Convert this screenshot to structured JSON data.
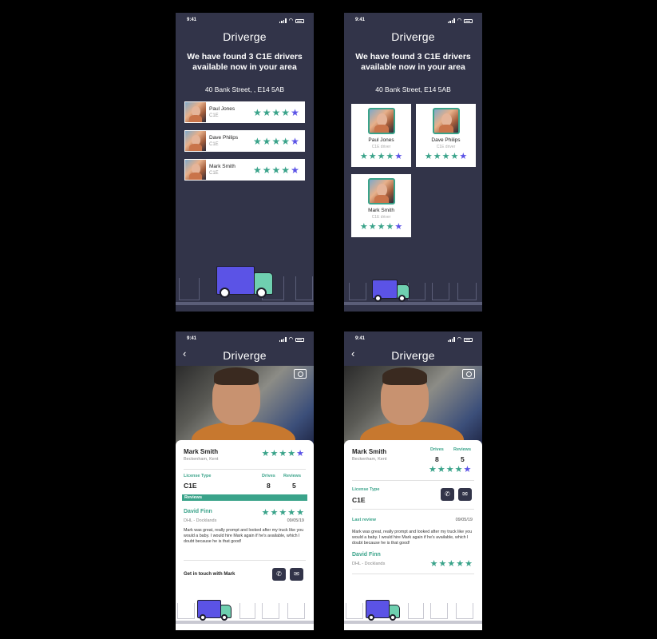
{
  "status_time": "9:41",
  "brand": "Driverge",
  "back_icon": "‹",
  "colors": {
    "bg": "#323449",
    "accent": "#3aa38a",
    "star_purple": "#5b53e6",
    "truck_box": "#5b53e6",
    "truck_cab": "#6fd0b0"
  },
  "icons": [
    "signal-icon",
    "wifi-icon",
    "battery-icon",
    "camera-icon",
    "phone-icon",
    "mail-icon",
    "star-icon",
    "truck-icon",
    "house-icon"
  ],
  "search": {
    "headline_line1": "We have found 3 C1E drivers",
    "headline_line2": "available now in your area",
    "address": "40 Bank Street, , E14 5AB",
    "address_alt": "40 Bank Street, E14 5AB"
  },
  "drivers": [
    {
      "name": "Paul Jones",
      "licence": "C1E",
      "card_licence": "C1E driver",
      "rating": 5
    },
    {
      "name": "Dave Philips",
      "licence": "C1E",
      "card_licence": "C1E driver",
      "rating": 4
    },
    {
      "name": "Mark Smith",
      "licence": "C1E",
      "card_licence": "C1E driver",
      "rating": 5
    }
  ],
  "profile": {
    "name": "Mark Smith",
    "location": "Beckenham, Kent",
    "rating": 5,
    "license_type_label": "License Type",
    "license_type": "C1E",
    "drives_label": "Drives",
    "drives": "8",
    "reviews_label": "Reviews",
    "reviews": "5",
    "reviews_header": "Reviews",
    "last_review_label": "Last review",
    "contact_label": "Get in touch with Mark",
    "phone_icon": "✆",
    "mail_icon": "✉",
    "review": {
      "reviewer": "David Finn",
      "company": "DHL - Docklands",
      "date": "09/05/19",
      "text": "Mark was great, really prompt and looked after my truck like you would a baby. I would hire Mark again if he's available, which I doubt because he is that good!",
      "rating": 5
    }
  }
}
